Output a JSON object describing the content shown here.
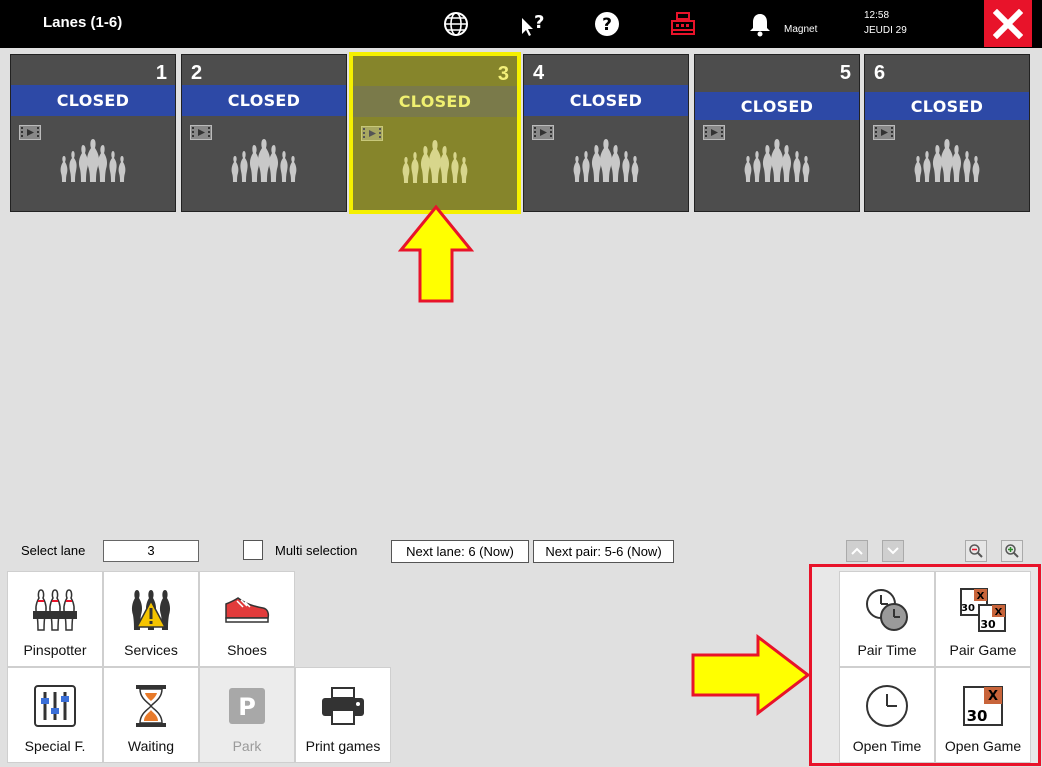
{
  "header": {
    "title": "Lanes (1-6)",
    "magnet_label": "Magnet",
    "time": "12:58",
    "date": "JEUDI 29"
  },
  "lanes": [
    {
      "number": "1",
      "status": "CLOSED"
    },
    {
      "number": "2",
      "status": "CLOSED"
    },
    {
      "number": "3",
      "status": "CLOSED"
    },
    {
      "number": "4",
      "status": "CLOSED"
    },
    {
      "number": "5",
      "status": "CLOSED"
    },
    {
      "number": "6",
      "status": "CLOSED"
    }
  ],
  "controls": {
    "select_lane_label": "Select lane",
    "select_lane_value": "3",
    "multi_selection_label": "Multi selection",
    "next_lane": "Next lane: 6 (Now)",
    "next_pair": "Next pair: 5-6 (Now)"
  },
  "tools": {
    "pinspotter": "Pinspotter",
    "services": "Services",
    "shoes": "Shoes",
    "special": "Special F.",
    "waiting": "Waiting",
    "park": "Park",
    "print_games": "Print games",
    "pair_time": "Pair Time",
    "pair_game": "Pair Game",
    "open_time": "Open Time",
    "open_game": "Open Game"
  },
  "game_icon_numbers": {
    "top": "30",
    "bottom": "30",
    "mark": "X"
  },
  "colors": {
    "status_blue": "#2d49a6",
    "selected_border": "#f5f000",
    "highlight_red": "#e8132a",
    "annotation_arrow": "#ffff00"
  }
}
